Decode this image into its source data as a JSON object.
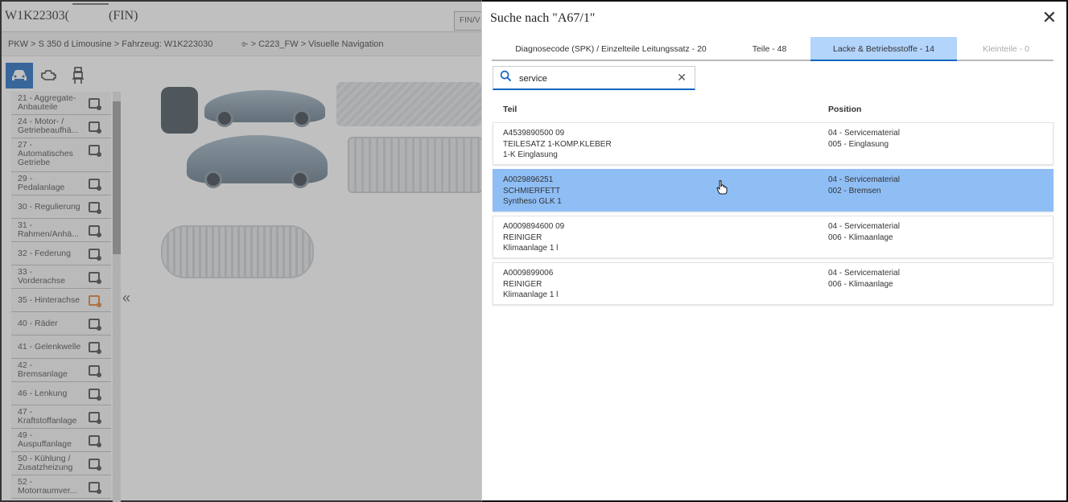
{
  "app": {
    "vin": "W1K22303(",
    "vin_suffix": "(FIN)",
    "fin_button": "FIN/V",
    "breadcrumb": "PKW > S 350 d Limousine > Fahrzeug: W1K223030",
    "breadcrumb_right": "⌱ > C223_FW > Visuelle Navigation",
    "collapse_icon": "«"
  },
  "sidebar": {
    "items": [
      {
        "label": "21 - Aggregate-\nAnbauteile",
        "active": false
      },
      {
        "label": "24 - Motor- /\nGetriebeaufhä...",
        "active": false
      },
      {
        "label": "27 -\nAutomatisches\nGetriebe",
        "active": false
      },
      {
        "label": "29 -\nPedalanlage",
        "active": false
      },
      {
        "label": "30 - Regulierung",
        "active": false
      },
      {
        "label": "31 -\nRahmen/Anhä...",
        "active": false
      },
      {
        "label": "32 - Federung",
        "active": false
      },
      {
        "label": "33 -\nVorderachse",
        "active": false
      },
      {
        "label": "35 - Hinterachse",
        "active": true
      },
      {
        "label": "40 - Räder",
        "active": false
      },
      {
        "label": "41 - Gelenkwelle",
        "active": false
      },
      {
        "label": "42 -\nBremsanlage",
        "active": false
      },
      {
        "label": "46 - Lenkung",
        "active": false
      },
      {
        "label": "47 -\nKraftstoffanlage",
        "active": false
      },
      {
        "label": "49 -\nAuspuffanlage",
        "active": false
      },
      {
        "label": "50 - Kühlung /\nZusatzheizung",
        "active": false
      },
      {
        "label": "52 -\nMotorraumver...",
        "active": false
      }
    ]
  },
  "panel": {
    "title": "Suche nach \"A67/1\"",
    "close_icon": "✕",
    "tabs": [
      {
        "label": "Diagnosecode (SPK) / Einzelteile Leitungssatz - 20",
        "state": "normal"
      },
      {
        "label": "Teile - 48",
        "state": "normal"
      },
      {
        "label": "Lacke & Betriebsstoffe - 14",
        "state": "active"
      },
      {
        "label": "Kleinteile - 0",
        "state": "disabled"
      }
    ],
    "search": {
      "value": "service",
      "clear_icon": "✕"
    },
    "columns": {
      "teil": "Teil",
      "position": "Position"
    },
    "results": [
      {
        "part_no": "A4539890500 09",
        "name": "TEILESATZ 1-KOMP.KLEBER",
        "desc": "1-K Einglasung",
        "pos1": "04 - Servicematerial",
        "pos2": "005 - Einglasung",
        "selected": false
      },
      {
        "part_no": "A0029896251",
        "name": "SCHMIERFETT",
        "desc": "Syntheso GLK 1",
        "pos1": "04 - Servicematerial",
        "pos2": "002 - Bremsen",
        "selected": true
      },
      {
        "part_no": "A0009894600 09",
        "name": "REINIGER",
        "desc": "Klimaanlage 1 l",
        "pos1": "04 - Servicematerial",
        "pos2": "006 - Klimaanlage",
        "selected": false
      },
      {
        "part_no": "A0009899006",
        "name": "REINIGER",
        "desc": "Klimaanlage 1 l",
        "pos1": "04 - Servicematerial",
        "pos2": "006 - Klimaanlage",
        "selected": false
      }
    ]
  },
  "colors": {
    "accent": "#1565c0",
    "tab_active_bg": "#b3d4fb",
    "row_selected_bg": "#8fbef5",
    "active_doc": "#e07a2b"
  }
}
